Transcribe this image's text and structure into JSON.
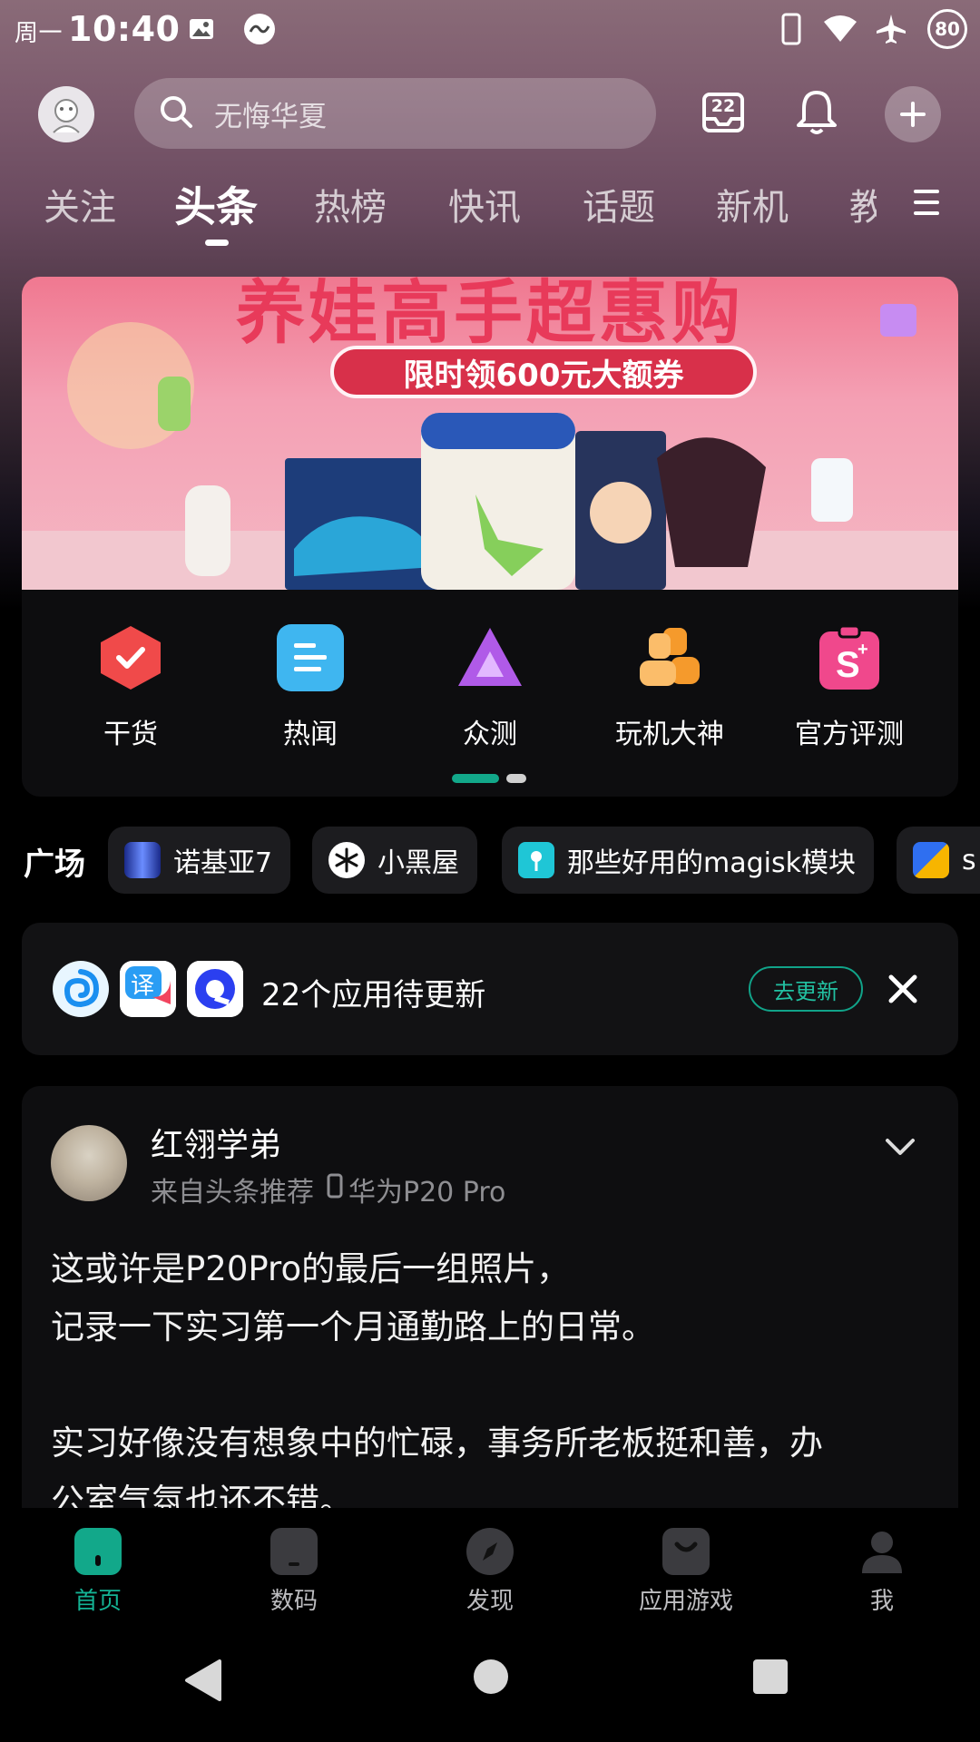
{
  "status_bar": {
    "weekday": "周一",
    "time": "10:40",
    "battery": "80",
    "icons": [
      "image-icon",
      "vpn-icon",
      "phone-icon",
      "wifi-icon",
      "airplane-icon",
      "battery-icon"
    ]
  },
  "header": {
    "search_placeholder": "无悔华夏",
    "calendar_day": "22",
    "icons": [
      "avatar-icon",
      "search-icon",
      "calendar-icon",
      "bell-icon",
      "plus-icon"
    ]
  },
  "tabs": [
    {
      "label": "关注",
      "active": false
    },
    {
      "label": "头条",
      "active": true
    },
    {
      "label": "热榜",
      "active": false
    },
    {
      "label": "快讯",
      "active": false
    },
    {
      "label": "话题",
      "active": false
    },
    {
      "label": "新机",
      "active": false
    },
    {
      "label": "教",
      "active": false
    }
  ],
  "banner": {
    "title": "养娃高手超惠购",
    "subtitle": "限时领600元大额券"
  },
  "quick_entries": [
    {
      "label": "干货",
      "icon": "checkmark-shield-icon",
      "color": "#f04a4a"
    },
    {
      "label": "热闻",
      "icon": "document-icon",
      "color": "#3fb6f0"
    },
    {
      "label": "众测",
      "icon": "triangle-icon",
      "color": "#b05ae8"
    },
    {
      "label": "玩机大神",
      "icon": "users-icon",
      "color": "#f59a2c"
    },
    {
      "label": "官方评测",
      "icon": "badge-s-icon",
      "color": "#f0488c"
    }
  ],
  "square": {
    "label": "广场",
    "chips": [
      {
        "label": "诺基亚7"
      },
      {
        "label": "小黑屋"
      },
      {
        "label": "那些好用的magisk模块"
      },
      {
        "label": "s"
      }
    ]
  },
  "update_card": {
    "text": "22个应用待更新",
    "button": "去更新"
  },
  "post": {
    "author": "红翎学弟",
    "source": "来自头条推荐",
    "device": "华为P20 Pro",
    "lines": [
      "这或许是P20Pro的最后一组照片，",
      "记录一下实习第一个月通勤路上的日常。",
      "",
      "实习好像没有想象中的忙碌，事务所老板挺和善，办",
      "公室气氛也还不错。"
    ]
  },
  "bottom_nav": [
    {
      "label": "首页",
      "active": true
    },
    {
      "label": "数码",
      "active": false
    },
    {
      "label": "发现",
      "active": false
    },
    {
      "label": "应用游戏",
      "active": false
    },
    {
      "label": "我",
      "active": false
    }
  ],
  "colors": {
    "accent": "#12a88a",
    "banner_red": "#e83a5a"
  }
}
